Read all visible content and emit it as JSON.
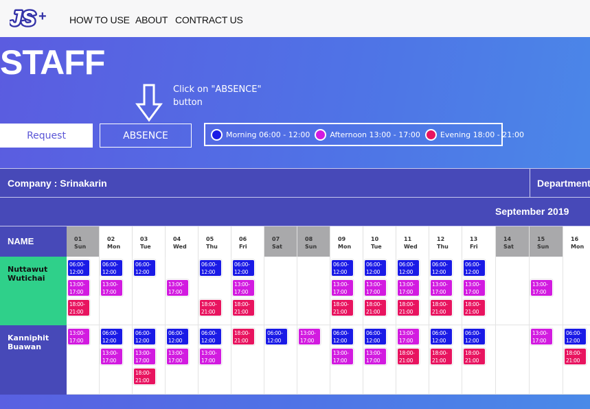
{
  "nav": {
    "logo_text": "JS+",
    "items": [
      "HOW TO USE",
      "ABOUT",
      "CONTRACT US"
    ]
  },
  "page": {
    "title": "STAFF",
    "hint": "Click on \"ABSENCE\" button"
  },
  "buttons": {
    "request": "Request",
    "absence": "ABSENCE"
  },
  "legend": [
    {
      "label": "Morning 06:00 - 12:00",
      "color": "#1a1ae6"
    },
    {
      "label": "Afternoon 13:00 - 17:00",
      "color": "#d21be0"
    },
    {
      "label": "Evening 18:00 - 21:00",
      "color": "#e8145f"
    }
  ],
  "company": {
    "label": "Company : Srinakarin",
    "department": "Department"
  },
  "month": "September 2019",
  "table": {
    "name_header": "NAME",
    "days": [
      {
        "num": "01",
        "dow": "Sun",
        "weekend": true
      },
      {
        "num": "02",
        "dow": "Mon",
        "weekend": false
      },
      {
        "num": "03",
        "dow": "Tue",
        "weekend": false
      },
      {
        "num": "04",
        "dow": "Wed",
        "weekend": false
      },
      {
        "num": "05",
        "dow": "Thu",
        "weekend": false
      },
      {
        "num": "06",
        "dow": "Fri",
        "weekend": false
      },
      {
        "num": "07",
        "dow": "Sat",
        "weekend": true
      },
      {
        "num": "08",
        "dow": "Sun",
        "weekend": true
      },
      {
        "num": "09",
        "dow": "Mon",
        "weekend": false
      },
      {
        "num": "10",
        "dow": "Tue",
        "weekend": false
      },
      {
        "num": "11",
        "dow": "Wed",
        "weekend": false
      },
      {
        "num": "12",
        "dow": "Thu",
        "weekend": false
      },
      {
        "num": "13",
        "dow": "Fri",
        "weekend": false
      },
      {
        "num": "14",
        "dow": "Sat",
        "weekend": true
      },
      {
        "num": "15",
        "dow": "Sun",
        "weekend": true
      },
      {
        "num": "16",
        "dow": "Mon",
        "weekend": false
      }
    ],
    "staff": [
      {
        "name": "Nuttawut Wutichai",
        "color": "#2fd08a",
        "shifts": [
          [
            "06:00-12:00",
            "13:00-17:00",
            "18:00-21:00"
          ],
          [
            "06:00-12:00",
            "13:00-17:00"
          ],
          [
            "06:00-12:00"
          ],
          [
            "13:00-17:00"
          ],
          [
            "06:00-12:00",
            "18:00-21:00"
          ],
          [
            "06:00-12:00",
            "13:00-17:00",
            "18:00-21:00"
          ],
          [],
          [],
          [
            "06:00-12:00",
            "13:00-17:00",
            "18:00-21:00"
          ],
          [
            "06:00-12:00",
            "13:00-17:00",
            "18:00-21:00"
          ],
          [
            "06:00-12:00",
            "13:00-17:00",
            "18:00-21:00"
          ],
          [
            "06:00-12:00",
            "13:00-17:00",
            "18:00-21:00"
          ],
          [
            "06:00-12:00",
            "13:00-17:00",
            "18:00-21:00"
          ],
          [],
          [
            "13:00-17:00"
          ],
          []
        ]
      },
      {
        "name": "Kanniphit Buawan",
        "color": "#4749b8",
        "shifts": [
          [
            "13:00-17:00"
          ],
          [
            "06:00-12:00",
            "13:00-17:00"
          ],
          [
            "06:00-12:00",
            "13:00-17:00",
            "18:00-21:00"
          ],
          [
            "06:00-12:00",
            "13:00-17:00"
          ],
          [
            "06:00-12:00",
            "13:00-17:00"
          ],
          [
            "18:00-21:00"
          ],
          [
            "06:00-12:00"
          ],
          [
            "13:00-17:00"
          ],
          [
            "06:00-12:00",
            "13:00-17:00"
          ],
          [
            "06:00-12:00",
            "13:00-17:00"
          ],
          [
            "13:00-17:00",
            "18:00-21:00"
          ],
          [
            "06:00-12:00",
            "18:00-21:00"
          ],
          [
            "06:00-12:00",
            "18:00-21:00"
          ],
          [],
          [
            "13:00-17:00"
          ],
          [
            "06:00-12:00",
            "18:00-21:00"
          ]
        ]
      }
    ]
  }
}
